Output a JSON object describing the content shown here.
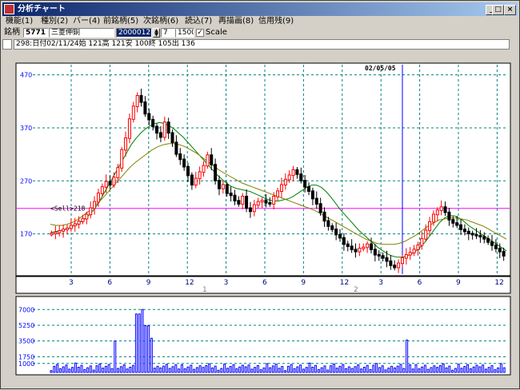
{
  "window": {
    "title": "分析チャート",
    "btn_min": "_",
    "btn_max": "□",
    "btn_close": "×"
  },
  "menu": [
    {
      "id": "kinou",
      "label": "機能(1)"
    },
    {
      "id": "shurui",
      "label": "種別(2)"
    },
    {
      "id": "bar",
      "label": "バー(4)"
    },
    {
      "id": "prev",
      "label": "前銘柄(5)"
    },
    {
      "id": "next",
      "label": "次銘柄(6)"
    },
    {
      "id": "read",
      "label": "読込(7)"
    },
    {
      "id": "redraw",
      "label": "再描画(8)"
    },
    {
      "id": "credit",
      "label": "信用残(9)"
    }
  ],
  "toolbar": {
    "label": "銘柄",
    "code": "5771",
    "name": "三菱伸銅",
    "date": "20000123",
    "period": "7",
    "count": "1500",
    "scale_checked": "✓",
    "scale_label": "Scale"
  },
  "info_line": "298:日付02/11/24始 121高 121安 100終 105出 136",
  "cursor_date": "02/05/05",
  "sell_marker": "<Sell>218",
  "colors": {
    "up": "#ff0000",
    "down": "#000000",
    "ma_short": "#008000",
    "ma_long": "#808000",
    "grid": "#008080",
    "cursor": "#0000ff",
    "signal": "#ff00ff",
    "volume": "#0000ff"
  },
  "chart_data": [
    {
      "type": "candlestick",
      "y_ticks": [
        "470",
        "370",
        "270",
        "170"
      ],
      "ylim": [
        100,
        480
      ],
      "x_ticks": [
        "3",
        "6",
        "9",
        "12",
        "3",
        "6",
        "9",
        "12",
        "3",
        "6",
        "9",
        "12"
      ],
      "year_labels": [
        "1",
        "2"
      ],
      "signal_line": 218,
      "close_points": [
        170,
        172,
        175,
        178,
        180,
        185,
        188,
        193,
        198,
        206,
        218,
        230,
        246,
        258,
        268,
        262,
        276,
        294,
        328,
        350,
        386,
        410,
        430,
        418,
        396,
        385,
        372,
        360,
        352,
        380,
        360,
        342,
        320,
        310,
        296,
        280,
        262,
        274,
        286,
        298,
        318,
        300,
        270,
        255,
        262,
        246,
        242,
        232,
        226,
        240,
        218,
        212,
        224,
        230,
        232,
        228,
        226,
        240,
        250,
        262,
        272,
        280,
        290,
        282,
        270,
        258,
        250,
        236,
        226,
        210,
        194,
        184,
        178,
        168,
        162,
        150,
        146,
        140,
        136,
        142,
        144,
        150,
        140,
        130,
        128,
        124,
        118,
        110,
        106,
        114,
        124,
        130,
        134,
        140,
        148,
        160,
        176,
        192,
        206,
        214,
        220,
        210,
        196,
        190,
        186,
        178,
        174,
        170,
        168,
        166,
        164,
        160,
        154,
        148,
        142,
        136,
        128
      ],
      "ma_short_points": [
        172,
        174,
        176,
        178,
        181,
        186,
        190,
        196,
        204,
        214,
        226,
        242,
        258,
        274,
        290,
        306,
        322,
        338,
        350,
        360,
        368,
        374,
        378,
        380,
        378,
        374,
        368,
        360,
        352,
        342,
        332,
        322,
        312,
        302,
        292,
        282,
        274,
        266,
        260,
        256,
        254,
        252,
        250,
        246,
        242,
        238,
        234,
        232,
        232,
        234,
        236,
        240,
        246,
        252,
        258,
        262,
        262,
        258,
        250,
        240,
        228,
        216,
        206,
        196,
        186,
        176,
        168,
        160,
        152,
        144,
        138,
        132,
        128,
        126,
        126,
        128,
        132,
        138,
        146,
        156,
        168,
        180,
        192,
        200,
        204,
        204,
        200,
        194,
        186,
        180,
        174,
        168,
        162,
        156,
        150,
        144,
        138
      ],
      "ma_long_points": [
        188,
        186,
        186,
        188,
        192,
        198,
        206,
        214,
        224,
        234,
        246,
        258,
        270,
        282,
        294,
        304,
        312,
        320,
        328,
        334,
        338,
        340,
        340,
        338,
        334,
        328,
        322,
        314,
        306,
        298,
        290,
        284,
        278,
        272,
        266,
        262,
        258,
        254,
        250,
        246,
        242,
        238,
        234,
        230,
        226,
        222,
        218,
        214,
        208,
        202,
        196,
        190,
        184,
        178,
        172,
        166,
        160,
        156,
        152,
        150,
        150,
        150,
        152,
        156,
        162,
        168,
        176,
        184,
        190,
        196,
        198,
        200,
        200,
        198,
        196,
        192,
        188,
        184,
        178,
        172,
        166,
        160
      ],
      "volume_ylim": [
        0,
        8000
      ],
      "volume_ticks": [
        "7000",
        "5250",
        "3500",
        "1750",
        "1000"
      ],
      "volume_spikes": [
        {
          "x": 0.14,
          "v": 3500
        },
        {
          "x": 0.19,
          "v": 6500
        },
        {
          "x": 0.2,
          "v": 7000
        },
        {
          "x": 0.21,
          "v": 5200
        },
        {
          "x": 0.22,
          "v": 3800
        },
        {
          "x": 0.78,
          "v": 3600
        }
      ]
    }
  ]
}
